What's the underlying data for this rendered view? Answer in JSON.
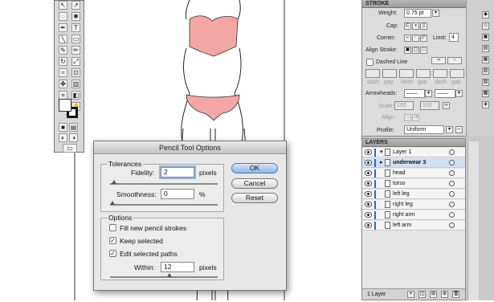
{
  "stroke_panel": {
    "title": "STROKE",
    "weight_label": "Weight:",
    "weight_value": "0.75 pt",
    "cap_label": "Cap:",
    "corner_label": "Corner:",
    "limit_label": "Limit:",
    "limit_value": "4",
    "align_label": "Align Stroke:",
    "dashed_label": "Dashed Line",
    "dash_labels": [
      "dash",
      "gap",
      "dash",
      "gap",
      "dash",
      "gap"
    ],
    "arrowheads_label": "Arrowheads:",
    "scale_label": "Scale:",
    "scale_values": [
      "100",
      "100"
    ],
    "align_arrow_label": "Align:",
    "profile_label": "Profile:",
    "profile_value": "Uniform"
  },
  "layers_panel": {
    "title": "LAYERS",
    "parent_layer": "Layer 1",
    "items": [
      {
        "name": "underwear 3",
        "selected": true
      },
      {
        "name": "head",
        "selected": false
      },
      {
        "name": "torso",
        "selected": false
      },
      {
        "name": "left leg",
        "selected": false
      },
      {
        "name": "right leg",
        "selected": false
      },
      {
        "name": "right arm",
        "selected": false
      },
      {
        "name": "left arm",
        "selected": false
      }
    ],
    "footer_count": "1 Layer",
    "layer_color": "#3a5fcc"
  },
  "dialog": {
    "title": "Pencil Tool Options",
    "tolerances_label": "Tolerances",
    "fidelity_label": "Fidelity:",
    "fidelity_value": "2",
    "fidelity_unit": "pixels",
    "smoothness_label": "Smoothness:",
    "smoothness_value": "0",
    "smoothness_unit": "%",
    "options_label": "Options",
    "fill_label": "Fill new pencil strokes",
    "fill_checked": false,
    "keep_label": "Keep selected",
    "keep_checked": true,
    "edit_label": "Edit selected paths",
    "edit_checked": true,
    "within_label": "Within:",
    "within_value": "12",
    "within_unit": "pixels",
    "ok_label": "OK",
    "cancel_label": "Cancel",
    "reset_label": "Reset"
  },
  "colors": {
    "underwear_fill": "#f2a7a4",
    "focus_ring": "#8fb3e3",
    "default_button": "#8eb6e6"
  }
}
